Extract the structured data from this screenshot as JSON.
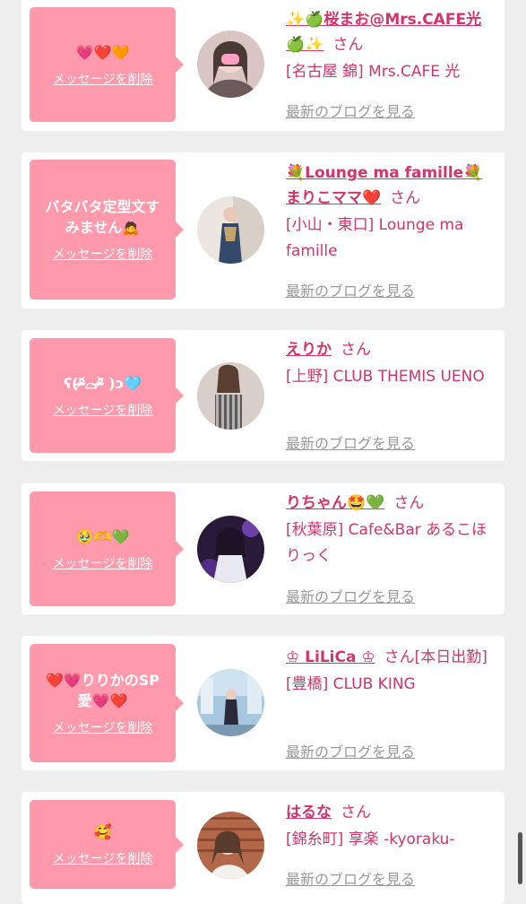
{
  "delete_label": "メッセージを削除",
  "blog_label": "最新のブログを見る",
  "san_label": "さん",
  "cards": [
    {
      "message": "💗❤️🧡",
      "name": "✨🍏桜まお@Mrs.CAFE光🍏✨",
      "suffix": "",
      "shop": "[名古屋 錦] Mrs.CAFE 光",
      "avatar_icon": "avatar-photo"
    },
    {
      "message": "バタバタ定型文すみません🙇",
      "name": "💐Lounge ma famille💐まりこママ❤️",
      "suffix": "",
      "shop": "[小山・東口] Lounge ma famille",
      "avatar_icon": "avatar-photo"
    },
    {
      "message": "ʕ(ᵒ̴̶̷᷄⌓ᵒ̴̶̷᷅ )ɔ🩵",
      "name": "えりか",
      "suffix": "",
      "shop": "[上野] CLUB THEMIS UENO",
      "avatar_icon": "avatar-photo"
    },
    {
      "message": "🥹🫶💚",
      "name": "りちゃん🤩💚",
      "suffix": "",
      "shop": "[秋葉原] Cafe&Bar あるこほりっく",
      "avatar_icon": "avatar-photo"
    },
    {
      "message": "❤️💗りりかのSP愛💗❤️",
      "name": "♔ LiLiCa ♔",
      "suffix": "[本日出勤]",
      "shop": "[豊橋] CLUB KING",
      "avatar_icon": "avatar-photo"
    },
    {
      "message": "🥰",
      "name": "はるな",
      "suffix": "",
      "shop": "[錦糸町] 享楽 -kyoraku-",
      "avatar_icon": "avatar-photo"
    }
  ],
  "colors": {
    "accent": "#d3346a",
    "bubble": "#ff99ab",
    "background": "#eeeeee"
  }
}
